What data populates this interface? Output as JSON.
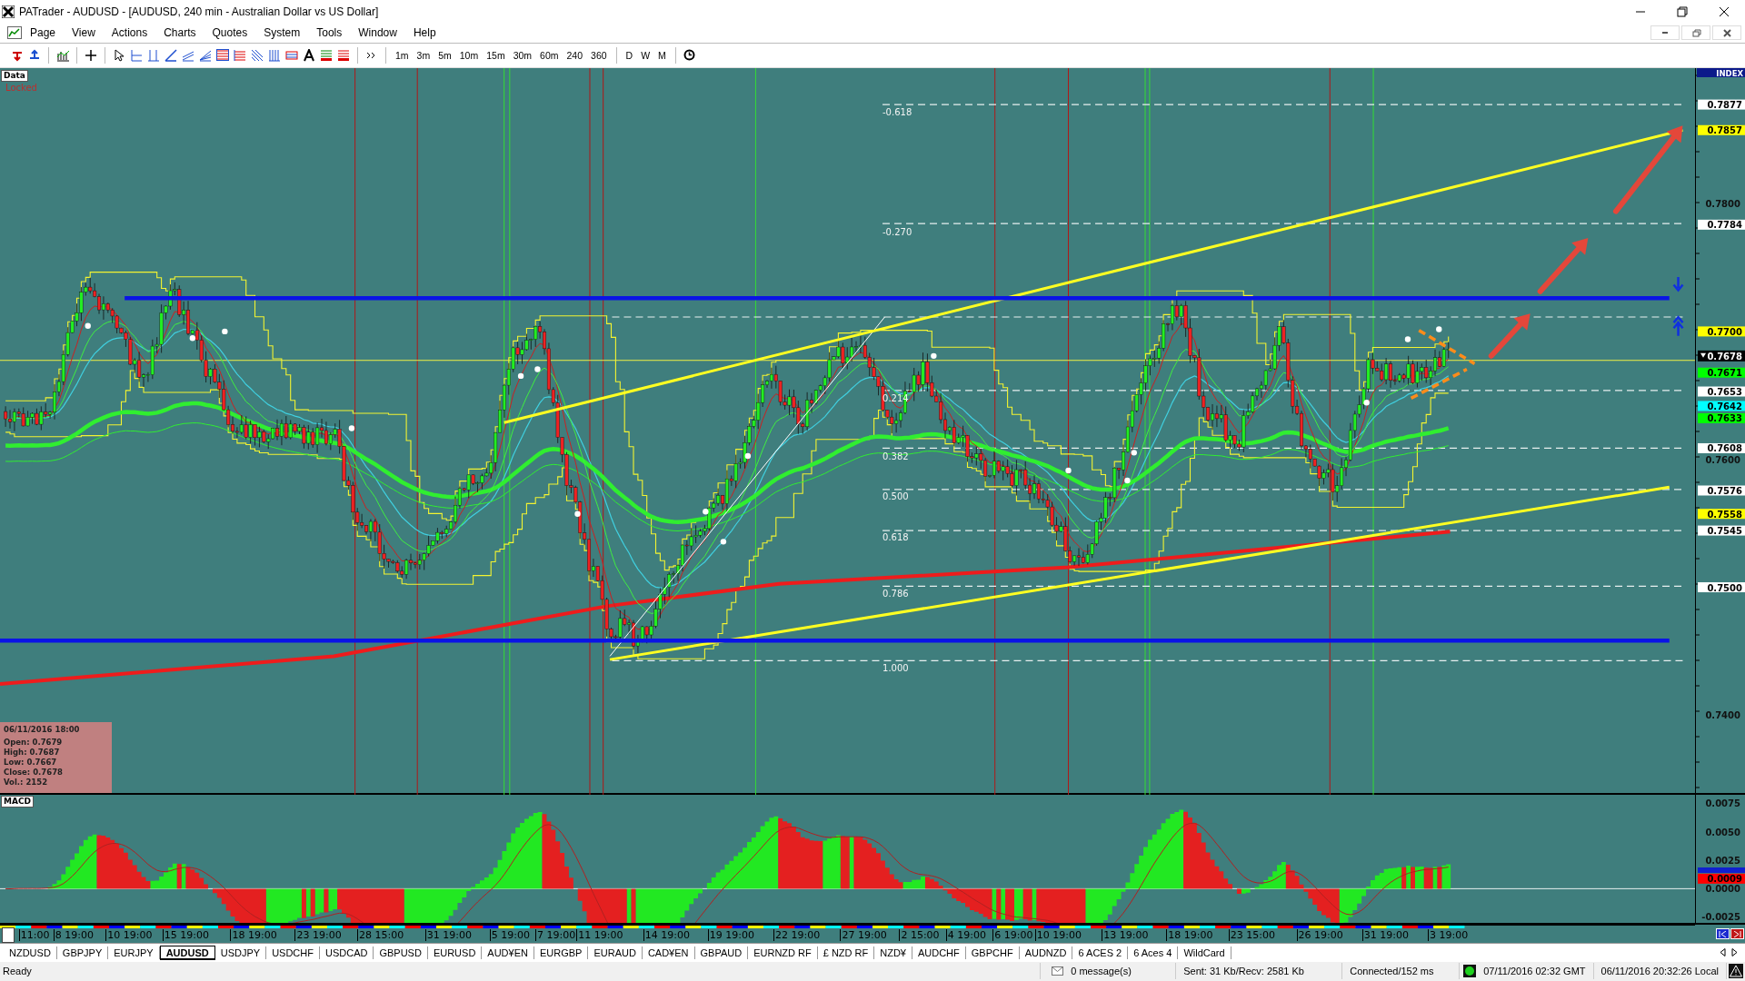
{
  "window": {
    "title": "PATrader - AUDUSD - [AUDUSD, 240 min - Australian Dollar vs US Dollar]"
  },
  "menu": [
    "Page",
    "View",
    "Actions",
    "Charts",
    "Quotes",
    "System",
    "Tools",
    "Window",
    "Help"
  ],
  "toolbar": {
    "timeframes": [
      "1m",
      "3m",
      "5m",
      "10m",
      "15m",
      "30m",
      "60m",
      "240",
      "360"
    ],
    "periods": [
      "D",
      "W",
      "M"
    ]
  },
  "chart": {
    "data_button": "Data",
    "lock_status": "Locked",
    "axis_header": "INDEX",
    "price_labels": [
      {
        "text": "0.7877",
        "kind": "marker",
        "color": "#ffffff"
      },
      {
        "text": "0.7857",
        "kind": "marker",
        "color": "#ffff00"
      },
      {
        "text": "0.7800",
        "kind": "tick"
      },
      {
        "text": "0.7784",
        "kind": "marker",
        "color": "#ffffff"
      },
      {
        "text": "0.7700",
        "kind": "marker",
        "color": "#ffff00"
      },
      {
        "text": "0.7678",
        "kind": "current",
        "color": "#000000"
      },
      {
        "text": "0.7671",
        "kind": "marker",
        "color": "#00ff00"
      },
      {
        "text": "0.7653",
        "kind": "marker",
        "color": "#ffffff"
      },
      {
        "text": "0.7642",
        "kind": "marker",
        "color": "#00ffff"
      },
      {
        "text": "0.7633",
        "kind": "marker",
        "color": "#00ff00"
      },
      {
        "text": "0.7608",
        "kind": "marker",
        "color": "#ffffff"
      },
      {
        "text": "0.7600",
        "kind": "tick"
      },
      {
        "text": "0.7576",
        "kind": "marker",
        "color": "#ffffff"
      },
      {
        "text": "0.7558",
        "kind": "marker",
        "color": "#ffff00"
      },
      {
        "text": "0.7545",
        "kind": "marker",
        "color": "#ffffff"
      },
      {
        "text": "0.7500",
        "kind": "marker",
        "color": "#ffffff"
      },
      {
        "text": "0.7400",
        "kind": "tick"
      }
    ],
    "fib_levels": [
      "-0.618",
      "-0.270",
      "0.214",
      "0.382",
      "0.500",
      "0.618",
      "0.786",
      "1.000"
    ],
    "info_box": {
      "title": "06/11/2016 18:00",
      "lines": [
        "Open: 0.7679",
        "High: 0.7687",
        "Low: 0.7667",
        "Close: 0.7678",
        "Vol.: 2152"
      ]
    },
    "macd": {
      "label": "MACD",
      "axis_labels": [
        {
          "text": "0.0075",
          "kind": "tick"
        },
        {
          "text": "0.0050",
          "kind": "tick"
        },
        {
          "text": "0.0025",
          "kind": "tick"
        },
        {
          "text": "0.0009",
          "kind": "marker",
          "color": "#ff0000"
        },
        {
          "text": "0.0000",
          "kind": "tick"
        },
        {
          "text": "-0.0025",
          "kind": "tick"
        }
      ]
    },
    "time_labels": [
      "11:00",
      "8 19:00",
      "10 19:00",
      "15 19:00",
      "18 19:00",
      "23 19:00",
      "28 15:00",
      "31 19:00",
      "5 19:00",
      "7 19:00",
      "11 19:00",
      "14 19:00",
      "19 19:00",
      "22 19:00",
      "27 19:00",
      "2 15:00",
      "4 19:00",
      "6 19:00",
      "10 19:00",
      "13 19:00",
      "18 19:00",
      "23 15:00",
      "26 19:00",
      "31 19:00",
      "3 19:00"
    ]
  },
  "symbol_tabs": [
    {
      "label": "NZDUSD",
      "selected": false
    },
    {
      "label": "GBPJPY",
      "selected": false
    },
    {
      "label": "EURJPY",
      "selected": false
    },
    {
      "label": "AUDUSD",
      "selected": true
    },
    {
      "label": "USDJPY",
      "selected": false
    },
    {
      "label": "USDCHF",
      "selected": false
    },
    {
      "label": "USDCAD",
      "selected": false
    },
    {
      "label": "GBPUSD",
      "selected": false
    },
    {
      "label": "EURUSD",
      "selected": false
    },
    {
      "label": "AUD¥EN",
      "selected": false
    },
    {
      "label": "EURGBP",
      "selected": false
    },
    {
      "label": "EURAUD",
      "selected": false
    },
    {
      "label": "CAD¥EN",
      "selected": false
    },
    {
      "label": "GBPAUD",
      "selected": false
    },
    {
      "label": "EURNZD RF",
      "selected": false
    },
    {
      "label": "£ NZD RF",
      "selected": false
    },
    {
      "label": "NZD¥",
      "selected": false
    },
    {
      "label": "AUDCHF",
      "selected": false
    },
    {
      "label": "GBPCHF",
      "selected": false
    },
    {
      "label": "AUDNZD",
      "selected": false
    },
    {
      "label": "6 ACES 2",
      "selected": false
    },
    {
      "label": "6 Aces 4",
      "selected": false
    },
    {
      "label": "WildCard",
      "selected": false
    }
  ],
  "status_bar": {
    "ready": "Ready",
    "messages": "0 message(s)",
    "traffic": "Sent: 31 Kb/Recv: 2581 Kb",
    "connection": "Connected/152 ms",
    "gmt_time": "07/11/2016 02:32 GMT",
    "local_time": "06/11/2016 20:32:26 Local"
  }
}
